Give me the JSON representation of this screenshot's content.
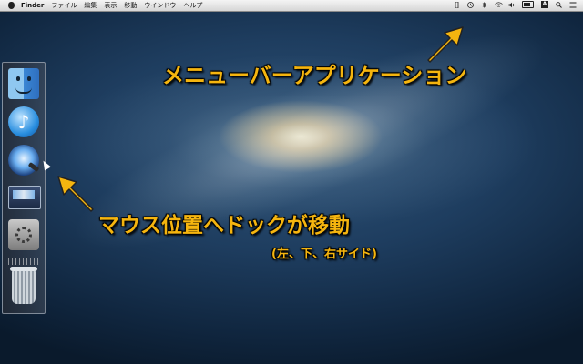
{
  "menubar": {
    "app_name": "Finder",
    "items": [
      "ファイル",
      "編集",
      "表示",
      "移動",
      "ウインドウ",
      "ヘルプ"
    ],
    "input_method": "A"
  },
  "dock": {
    "icons": [
      "finder-icon",
      "itunes-icon",
      "quicktime-icon",
      "mission-control-icon",
      "system-preferences-icon",
      "trash-icon"
    ]
  },
  "annotations": {
    "menubar_label": "メニューバーアプリケーション",
    "dock_label": "マウス位置へドックが移動",
    "sides_label": "(左、下、右サイド)"
  },
  "colors": {
    "annotation": "#f5b50f"
  }
}
